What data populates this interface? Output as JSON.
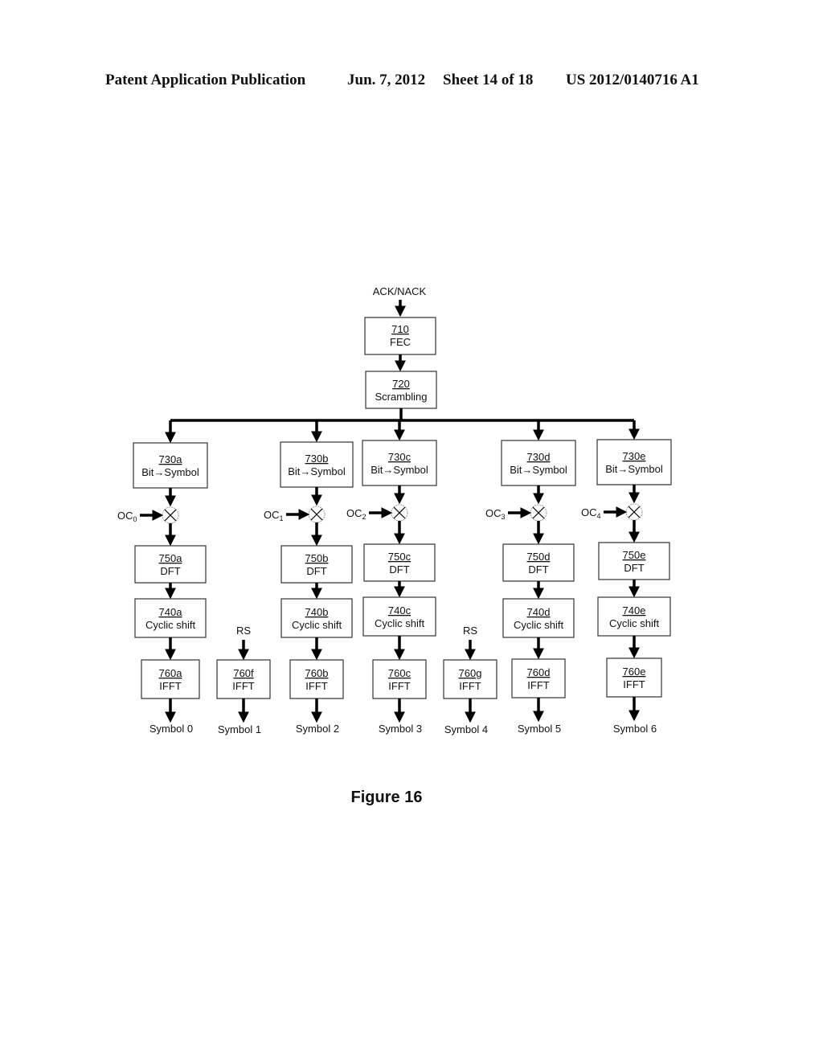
{
  "header": {
    "publication": "Patent Application Publication",
    "date": "Jun. 7, 2012",
    "sheet": "Sheet 14 of 18",
    "number": "US 2012/0140716 A1"
  },
  "diagram": {
    "input_label": "ACK/NACK",
    "fec": {
      "ref": "710",
      "label": "FEC"
    },
    "scrambling": {
      "ref": "720",
      "label": "Scrambling"
    },
    "branches": [
      {
        "mapper": {
          "ref": "730a",
          "label": "Bit→Symbol"
        },
        "oc": "OC",
        "oc_sub": "0",
        "dft": {
          "ref": "750a",
          "label": "DFT"
        },
        "shift": {
          "ref": "740a",
          "label": "Cyclic shift"
        },
        "ifft": {
          "ref": "760a",
          "label": "IFFT"
        },
        "symbol": "Symbol 0"
      },
      {
        "mapper": {
          "ref": "730b",
          "label": "Bit→Symbol"
        },
        "oc": "OC",
        "oc_sub": "1",
        "dft": {
          "ref": "750b",
          "label": "DFT"
        },
        "shift": {
          "ref": "740b",
          "label": "Cyclic shift"
        },
        "ifft": {
          "ref": "760b",
          "label": "IFFT"
        },
        "symbol": "Symbol 2"
      },
      {
        "mapper": {
          "ref": "730c",
          "label": "Bit→Symbol"
        },
        "oc": "OC",
        "oc_sub": "2",
        "dft": {
          "ref": "750c",
          "label": "DFT"
        },
        "shift": {
          "ref": "740c",
          "label": "Cyclic shift"
        },
        "ifft": {
          "ref": "760c",
          "label": "IFFT"
        },
        "symbol": "Symbol 3"
      },
      {
        "mapper": {
          "ref": "730d",
          "label": "Bit→Symbol"
        },
        "oc": "OC",
        "oc_sub": "3",
        "dft": {
          "ref": "750d",
          "label": "DFT"
        },
        "shift": {
          "ref": "740d",
          "label": "Cyclic shift"
        },
        "ifft": {
          "ref": "760d",
          "label": "IFFT"
        },
        "symbol": "Symbol 5"
      },
      {
        "mapper": {
          "ref": "730e",
          "label": "Bit→Symbol"
        },
        "oc": "OC",
        "oc_sub": "4",
        "dft": {
          "ref": "750e",
          "label": "DFT"
        },
        "shift": {
          "ref": "740e",
          "label": "Cyclic shift"
        },
        "ifft": {
          "ref": "760e",
          "label": "IFFT"
        },
        "symbol": "Symbol 6"
      }
    ],
    "rs_branches": [
      {
        "input": "RS",
        "ifft": {
          "ref": "760f",
          "label": "IFFT"
        },
        "symbol": "Symbol 1"
      },
      {
        "input": "RS",
        "ifft": {
          "ref": "760g",
          "label": "IFFT"
        },
        "symbol": "Symbol 4"
      }
    ],
    "caption": "Figure 16"
  }
}
